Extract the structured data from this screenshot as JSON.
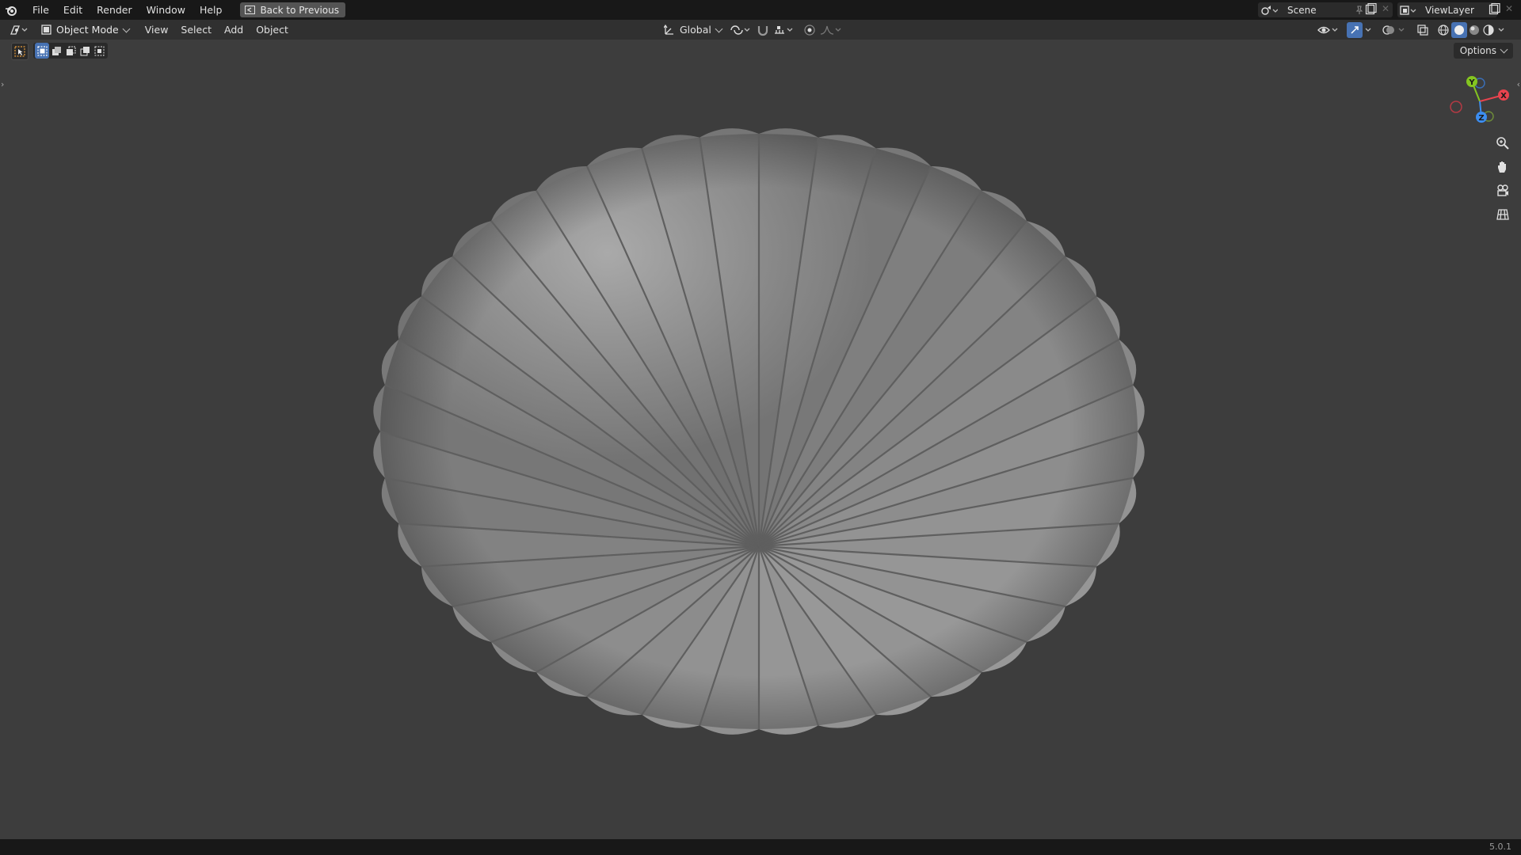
{
  "topbar": {
    "menus": [
      "File",
      "Edit",
      "Render",
      "Window",
      "Help"
    ],
    "back_button": "Back to Previous",
    "scene_name": "Scene",
    "view_layer": "ViewLayer"
  },
  "header": {
    "mode": "Object Mode",
    "menus": [
      "View",
      "Select",
      "Add",
      "Object"
    ],
    "transform_orientation": "Global"
  },
  "toolbar": {
    "options_label": "Options"
  },
  "gizmo": {
    "axes": [
      "X",
      "Y",
      "Z"
    ],
    "colors": {
      "x": "#e8434e",
      "y": "#84c520",
      "z": "#3c8df0"
    }
  },
  "viewport": {
    "background": "#3d3d3d",
    "object_color": "#8e8e8e",
    "ribs": 40
  },
  "status": {
    "version": "5.0.1"
  }
}
